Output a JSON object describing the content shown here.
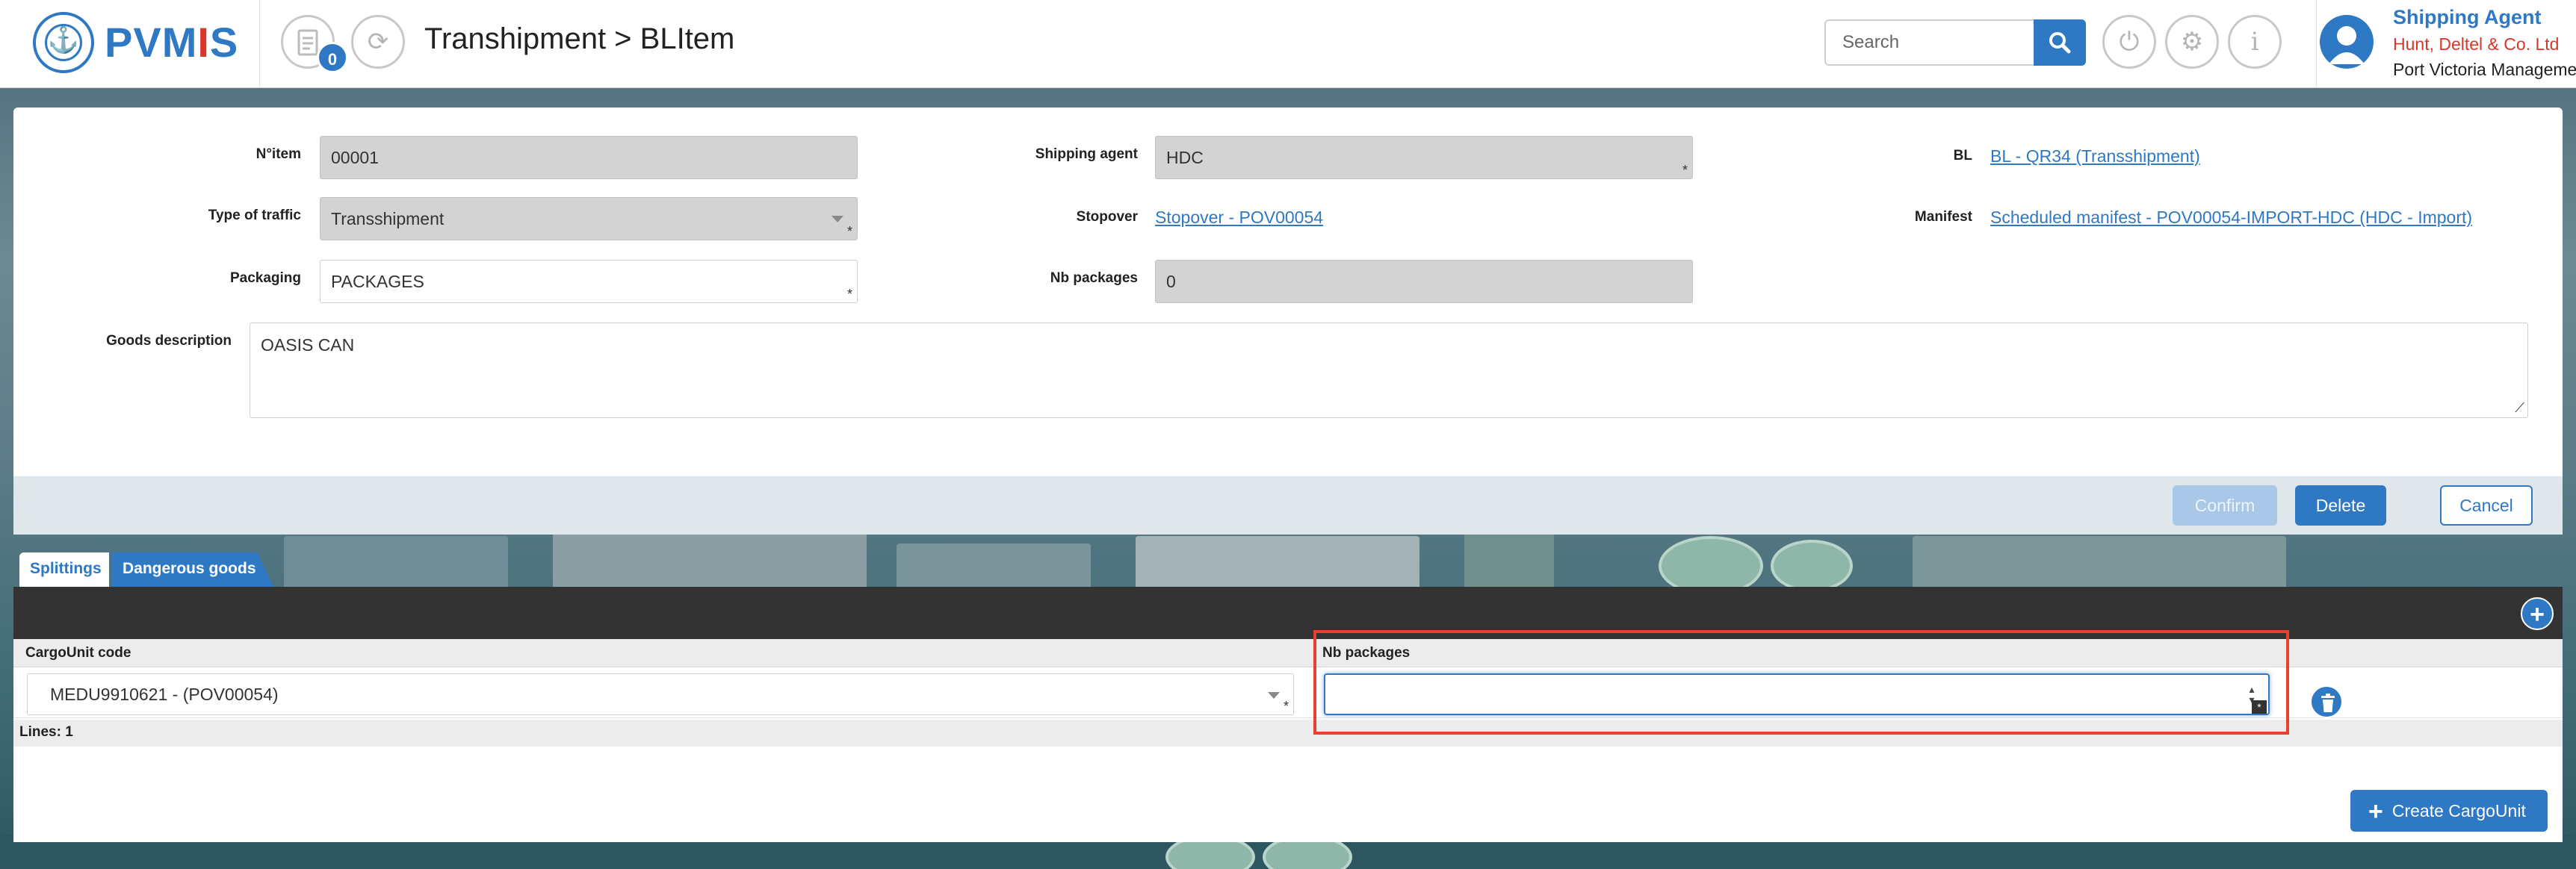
{
  "app": {
    "logo_main": "PVM",
    "logo_red": "I",
    "logo_tail": "S"
  },
  "header": {
    "badge_count": "0",
    "title": "Transhipment > BLItem",
    "search_placeholder": "Search",
    "user_role": "Shipping Agent",
    "user_company": "Hunt, Deltel & Co. Ltd",
    "user_org": "Port Victoria Management"
  },
  "form": {
    "item_label": "N°item",
    "item_value": "00001",
    "traffic_label": "Type of traffic",
    "traffic_value": "Transshipment",
    "packaging_label": "Packaging",
    "packaging_value": "PACKAGES",
    "agent_label": "Shipping agent",
    "agent_value": "HDC",
    "stopover_label": "Stopover",
    "stopover_link": "Stopover - POV00054",
    "nbpackages_label": "Nb packages",
    "nbpackages_value": "0",
    "bl_label": "BL",
    "bl_link": "BL - QR34 (Transshipment)",
    "manifest_label": "Manifest",
    "manifest_link": "Scheduled manifest - POV00054-IMPORT-HDC (HDC - Import)",
    "goods_label": "Goods description",
    "goods_value": "OASIS CAN"
  },
  "actions": {
    "confirm": "Confirm",
    "delete": "Delete",
    "cancel": "Cancel"
  },
  "tabs": [
    {
      "label": "Splittings"
    },
    {
      "label": "Dangerous goods"
    }
  ],
  "grid": {
    "columns": [
      "CargoUnit code",
      "Nb packages"
    ],
    "rows": [
      {
        "cargo_unit": "MEDU9910621 - (POV00054)",
        "nb_packages": ""
      }
    ],
    "lines": "Lines: 1"
  },
  "create_button": "Create CargoUnit",
  "colors": {
    "accent": "#2f78c4",
    "brand_red": "#d9372b",
    "highlight": "#e8422c"
  }
}
